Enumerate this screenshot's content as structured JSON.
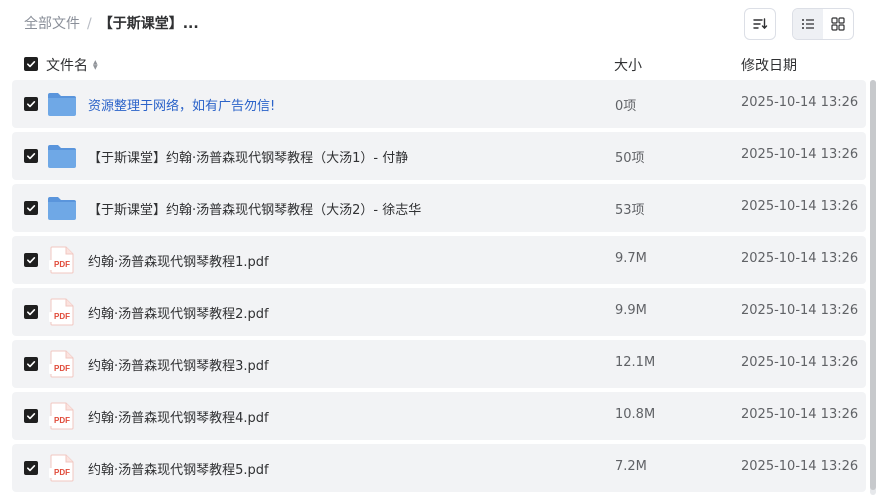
{
  "breadcrumb": {
    "root": "全部文件",
    "separator": "/",
    "current": "【于斯课堂】..."
  },
  "toolbar": {
    "sort_icon": "sort-lines-icon",
    "list_icon": "list-view-icon",
    "grid_icon": "grid-view-icon"
  },
  "columns": {
    "name": "文件名",
    "size": "大小",
    "modified": "修改日期"
  },
  "colors": {
    "link": "#2b63c9",
    "row_bg": "#f2f3f5",
    "folder": "#6fa8e6",
    "pdf_red": "#e04b3a"
  },
  "rows": [
    {
      "type": "folder",
      "icon": "folder-icon",
      "name": "资源整理于网络，如有广告勿信!",
      "size": "0项",
      "modified": "2025-10-14 13:26",
      "checked": true,
      "link": true
    },
    {
      "type": "folder",
      "icon": "folder-icon",
      "name": "【于斯课堂】约翰·汤普森现代钢琴教程（大汤1）- 付静",
      "size": "50项",
      "modified": "2025-10-14 13:26",
      "checked": true,
      "link": false
    },
    {
      "type": "folder",
      "icon": "folder-icon",
      "name": "【于斯课堂】约翰·汤普森现代钢琴教程（大汤2）- 徐志华",
      "size": "53项",
      "modified": "2025-10-14 13:26",
      "checked": true,
      "link": false
    },
    {
      "type": "pdf",
      "icon": "pdf-file-icon",
      "icon_label": "PDF",
      "name": "约翰·汤普森现代钢琴教程1.pdf",
      "size": "9.7M",
      "modified": "2025-10-14 13:26",
      "checked": true,
      "link": false
    },
    {
      "type": "pdf",
      "icon": "pdf-file-icon",
      "icon_label": "PDF",
      "name": "约翰·汤普森现代钢琴教程2.pdf",
      "size": "9.9M",
      "modified": "2025-10-14 13:26",
      "checked": true,
      "link": false
    },
    {
      "type": "pdf",
      "icon": "pdf-file-icon",
      "icon_label": "PDF",
      "name": "约翰·汤普森现代钢琴教程3.pdf",
      "size": "12.1M",
      "modified": "2025-10-14 13:26",
      "checked": true,
      "link": false
    },
    {
      "type": "pdf",
      "icon": "pdf-file-icon",
      "icon_label": "PDF",
      "name": "约翰·汤普森现代钢琴教程4.pdf",
      "size": "10.8M",
      "modified": "2025-10-14 13:26",
      "checked": true,
      "link": false
    },
    {
      "type": "pdf",
      "icon": "pdf-file-icon",
      "icon_label": "PDF",
      "name": "约翰·汤普森现代钢琴教程5.pdf",
      "size": "7.2M",
      "modified": "2025-10-14 13:26",
      "checked": true,
      "link": false
    }
  ]
}
